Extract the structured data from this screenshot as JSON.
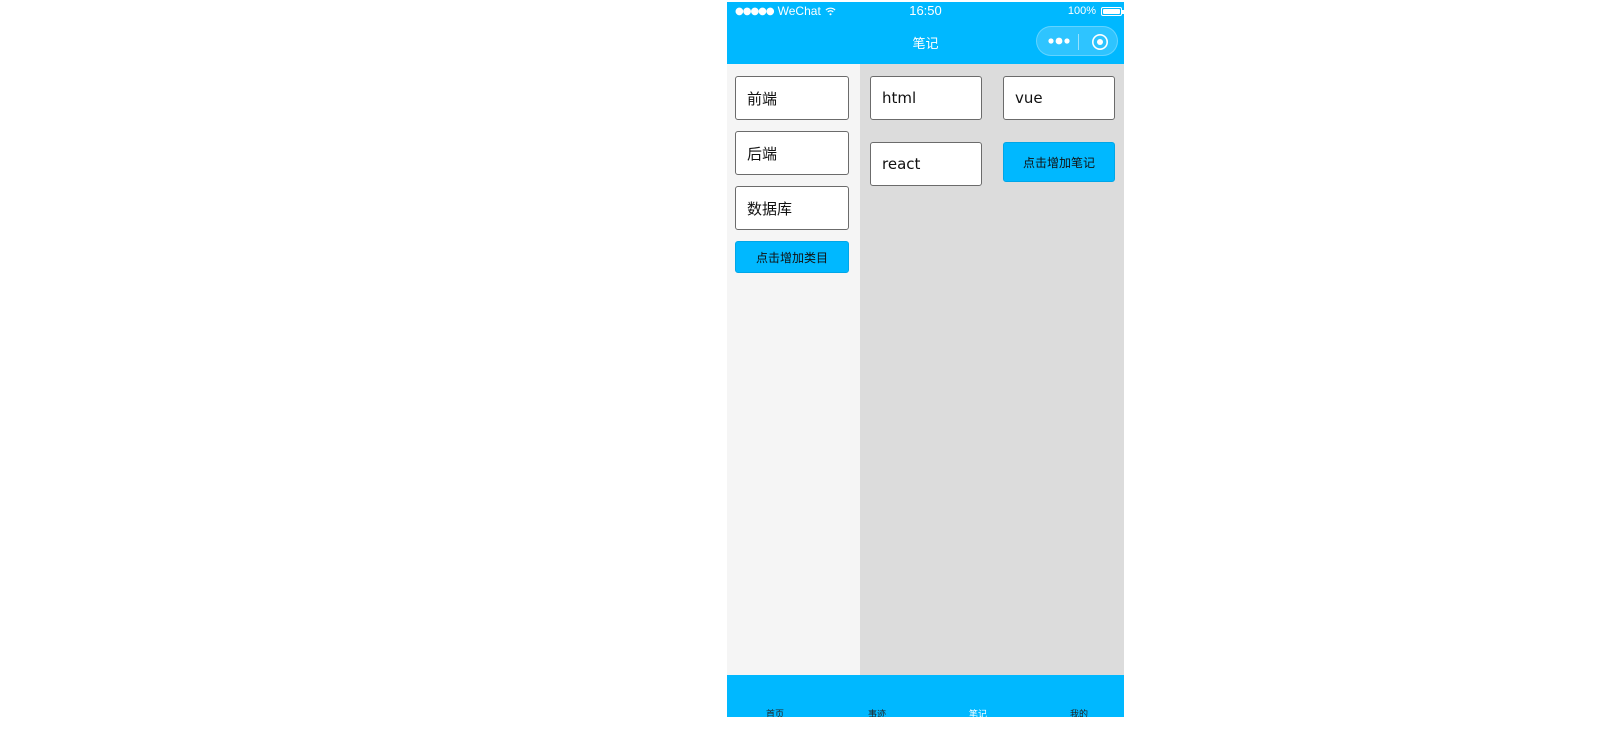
{
  "status_bar": {
    "signal": "●●●●●",
    "carrier": "WeChat",
    "time": "16:50",
    "battery": "100%"
  },
  "nav": {
    "title": "笔记",
    "more_icon": "more-dots-icon",
    "close_icon": "target-circle-icon"
  },
  "categories": {
    "items": [
      {
        "label": "前端"
      },
      {
        "label": "后端"
      },
      {
        "label": "数据库"
      }
    ],
    "add_button": "点击增加类目"
  },
  "notes": {
    "items": [
      {
        "label": "html"
      },
      {
        "label": "vue"
      },
      {
        "label": "react"
      }
    ],
    "add_button": "点击增加笔记"
  },
  "tabbar": {
    "tabs": [
      {
        "label": "首页"
      },
      {
        "label": "事迹"
      },
      {
        "label": "笔记"
      },
      {
        "label": "我的"
      }
    ],
    "active_index": 2
  },
  "colors": {
    "brand": "#00b8ff",
    "sidebar_bg": "#f5f5f5",
    "main_bg": "#dcdcdc"
  }
}
